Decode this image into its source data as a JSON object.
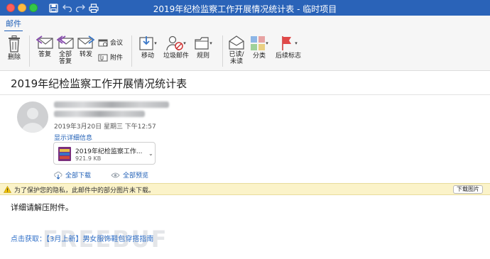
{
  "window": {
    "title": "2019年纪检监察工作开展情况统计表 - 临时项目"
  },
  "ribbon": {
    "tab": "邮件",
    "buttons": {
      "delete": "删除",
      "reply": "答复",
      "reply_all": "全部\n答复",
      "forward": "转发",
      "meeting": "会议",
      "attachment": "附件",
      "move": "移动",
      "junk": "垃圾邮件",
      "rules": "规则",
      "read_unread": "已读/\n未读",
      "categorize": "分类",
      "follow_up": "后续标志"
    }
  },
  "message": {
    "subject": "2019年纪检监察工作开展情况统计表",
    "date": "2019年3月20日 星期三 下午12:57",
    "show_details": "显示详细信息",
    "attachment": {
      "name": "2019年纪检监察工作...",
      "size": "921.9 KB"
    },
    "download_all": "全部下载",
    "preview_all": "全部预览",
    "privacy_notice": "为了保护您的隐私，此邮件中的部分图片未下载。",
    "download_images": "下载图片",
    "body": "详细请解压附件。",
    "promo_link": "点击获取：【3月上新】男女服饰鞋包穿搭指南"
  },
  "watermark": "FREEBUF",
  "colors": {
    "title_bar": "#2a63b8",
    "accent": "#1f5fb6",
    "privacy_bar": "#fbf3c9"
  }
}
